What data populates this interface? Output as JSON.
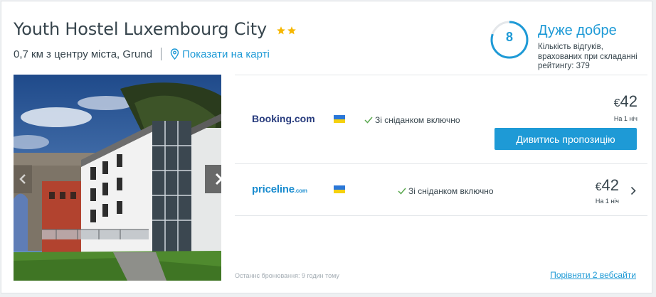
{
  "hotel": {
    "name": "Youth Hostel Luxembourg City",
    "stars": 2,
    "distance": "0,7 км з центру міста, Grund",
    "map_link": "Показати на карті"
  },
  "rating": {
    "score": "8",
    "label": "Дуже добре",
    "note": "Кількість відгуків, врахованих при складанні рейтингу: 379",
    "accent": "#1e9ad6"
  },
  "offers": [
    {
      "provider": "Booking.com",
      "feature": "Зі сніданком включно",
      "currency": "€",
      "price": "42",
      "per_night": "На 1 ніч",
      "cta": "Дивитись пропозицію"
    },
    {
      "provider": "priceline",
      "provider_suffix": ".com",
      "feature": "Зі сніданком включно",
      "currency": "€",
      "price": "42",
      "per_night": "На 1 ніч"
    }
  ],
  "footer": {
    "last_booked": "Останнє бронювання: 9 годин тому",
    "compare": "Порівняти 2 вебсайти"
  },
  "icons": [
    "star-icon",
    "map-pin-icon",
    "check-icon",
    "chevron-right-icon",
    "chevron-left-icon",
    "ukraine-flag-icon"
  ]
}
